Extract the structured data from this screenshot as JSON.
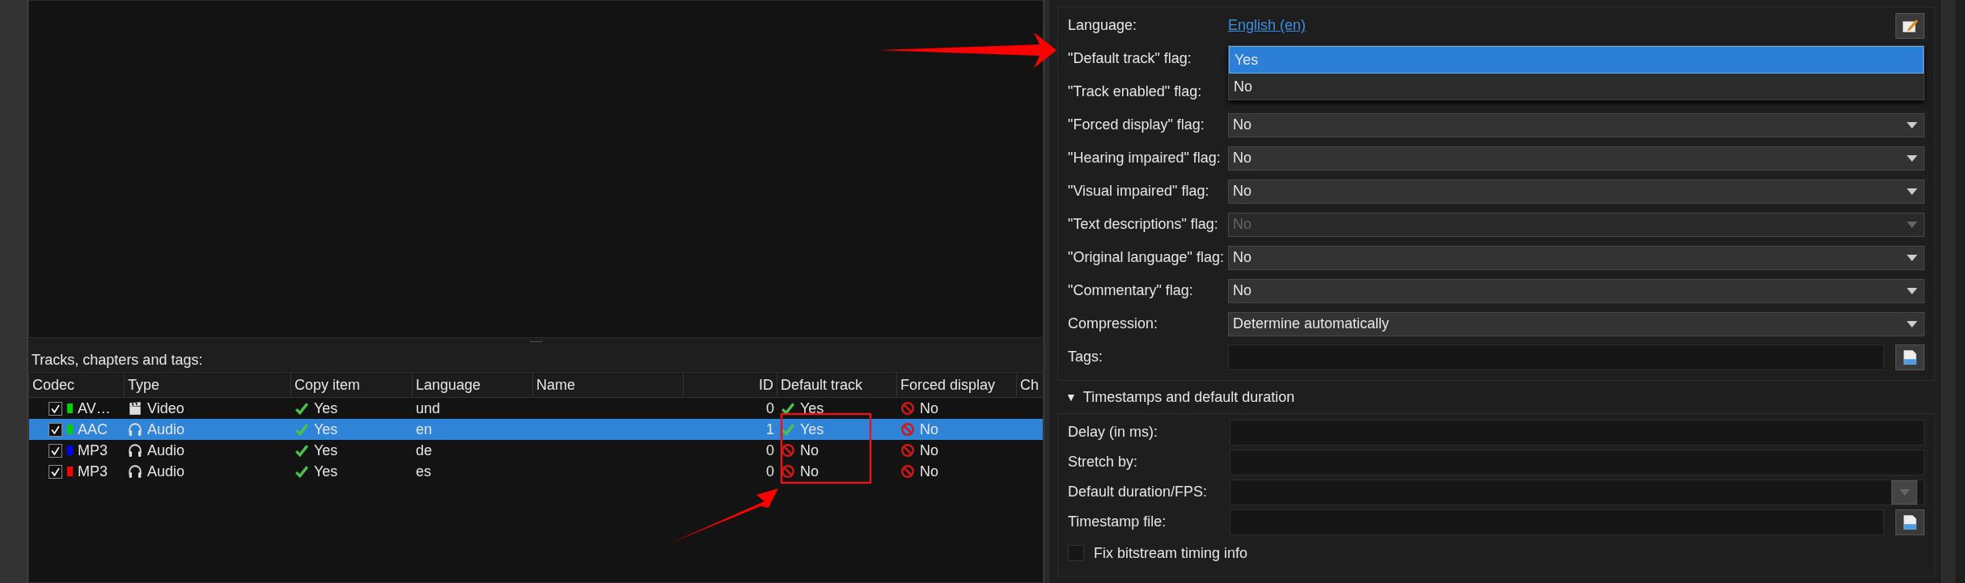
{
  "tracks_label": "Tracks, chapters and tags:",
  "table": {
    "columns": [
      "Codec",
      "Type",
      "Copy item",
      "Language",
      "Name",
      "ID",
      "Default track",
      "Forced display",
      "Ch"
    ],
    "rows": [
      {
        "checked": true,
        "color": "#00d000",
        "codec": "AV…",
        "kind": "video",
        "type": "Video",
        "copy_on": true,
        "copy": "Yes",
        "language": "und",
        "name": "",
        "id": "0",
        "default_on": true,
        "default_track": "Yes",
        "forced_on": false,
        "forced_display": "No",
        "selected": false
      },
      {
        "checked": true,
        "color": "#00d000",
        "codec": "AAC",
        "kind": "audio",
        "type": "Audio",
        "copy_on": true,
        "copy": "Yes",
        "language": "en",
        "name": "",
        "id": "1",
        "default_on": true,
        "default_track": "Yes",
        "forced_on": false,
        "forced_display": "No",
        "selected": true
      },
      {
        "checked": true,
        "color": "#0000ff",
        "codec": "MP3",
        "kind": "audio",
        "type": "Audio",
        "copy_on": true,
        "copy": "Yes",
        "language": "de",
        "name": "",
        "id": "0",
        "default_on": false,
        "default_track": "No",
        "forced_on": false,
        "forced_display": "No",
        "selected": false
      },
      {
        "checked": true,
        "color": "#ff0000",
        "codec": "MP3",
        "kind": "audio",
        "type": "Audio",
        "copy_on": true,
        "copy": "Yes",
        "language": "es",
        "name": "",
        "id": "0",
        "default_on": false,
        "default_track": "No",
        "forced_on": false,
        "forced_display": "No",
        "selected": false
      }
    ]
  },
  "properties": [
    {
      "kind": "link",
      "label": "Language:",
      "value": "English (en)"
    },
    {
      "kind": "dropdown_open",
      "label": "\"Default track\" flag:",
      "options": [
        {
          "label": "Yes",
          "selected": true
        },
        {
          "label": "No",
          "selected": false
        }
      ]
    },
    {
      "kind": "covered",
      "label": "\"Track enabled\" flag:"
    },
    {
      "kind": "combo",
      "label": "\"Forced display\" flag:",
      "value": "No",
      "disabled": false
    },
    {
      "kind": "combo",
      "label": "\"Hearing impaired\" flag:",
      "value": "No",
      "disabled": false
    },
    {
      "kind": "combo",
      "label": "\"Visual impaired\" flag:",
      "value": "No",
      "disabled": false
    },
    {
      "kind": "combo",
      "label": "\"Text descriptions\" flag:",
      "value": "No",
      "disabled": true
    },
    {
      "kind": "combo",
      "label": "\"Original language\" flag:",
      "value": "No",
      "disabled": false
    },
    {
      "kind": "combo",
      "label": "\"Commentary\" flag:",
      "value": "No",
      "disabled": false
    },
    {
      "kind": "combo",
      "label": "Compression:",
      "value": "Determine automatically",
      "disabled": false
    },
    {
      "kind": "file",
      "label": "Tags:"
    }
  ],
  "timestamps": {
    "toggle": "▼",
    "title": "Timestamps and default duration",
    "fields": [
      {
        "kind": "input",
        "label": "Delay (in ms):"
      },
      {
        "kind": "input",
        "label": "Stretch by:"
      },
      {
        "kind": "combo",
        "label": "Default duration/FPS:"
      },
      {
        "kind": "file",
        "label": "Timestamp file:"
      }
    ],
    "checkbox": {
      "label": "Fix bitstream timing info",
      "checked": false
    }
  }
}
